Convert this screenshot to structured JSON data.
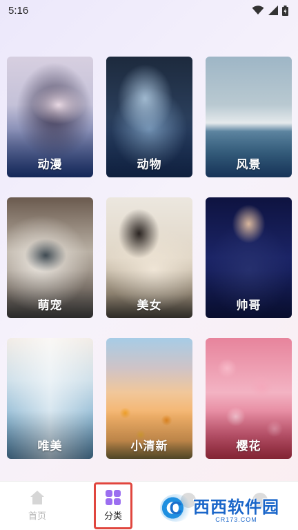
{
  "status_bar": {
    "time": "5:16",
    "icons": [
      "wifi-icon",
      "cell-signal-icon",
      "battery-icon"
    ]
  },
  "categories": [
    {
      "label": "动漫"
    },
    {
      "label": "动物"
    },
    {
      "label": "风景"
    },
    {
      "label": "萌宠"
    },
    {
      "label": "美女"
    },
    {
      "label": "帅哥"
    },
    {
      "label": "唯美"
    },
    {
      "label": "小清新"
    },
    {
      "label": "樱花"
    }
  ],
  "bottom_nav": {
    "home_label": "首页",
    "category_label": "分类",
    "active": "分类",
    "accent_color": "#9b6ef0",
    "highlight_color": "#e0463e"
  },
  "watermark": {
    "logo_letter": "C",
    "title": "西西软件园",
    "url": "CR173.COM"
  }
}
